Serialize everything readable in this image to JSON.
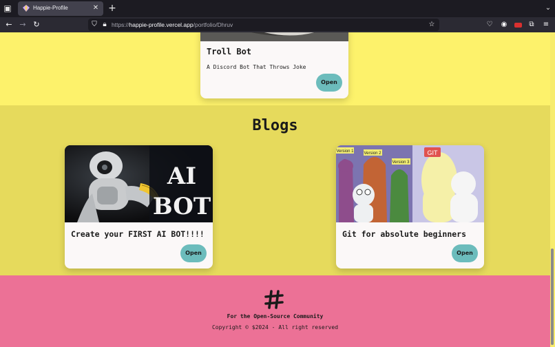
{
  "browser": {
    "tab_title": "Happie-Profile",
    "tab_close": "✕",
    "new_tab": "+",
    "url_prefix": "https://",
    "url_host": "happie-profile.vercel.app",
    "url_path": "/portfolio/Dhruv",
    "icons": [
      "tab-list-icon",
      "back-icon",
      "forward-icon",
      "reload-icon",
      "shield-icon",
      "lock-icon",
      "bookmark-star-icon",
      "pocket-icon",
      "account-icon",
      "extension-icon",
      "puzzle-icon",
      "menu-icon"
    ]
  },
  "projects": {
    "card": {
      "title": "Troll Bot",
      "description": "A Discord Bot That Throws Joke",
      "open_label": "Open"
    }
  },
  "blogs": {
    "heading": "Blogs",
    "cards": [
      {
        "title": "Create your FIRST AI BOT!!!!",
        "image_text_1": "AI",
        "image_text_2": "BOT",
        "open_label": "Open"
      },
      {
        "title": "Git for absolute beginners",
        "image_labels": [
          "Version 1",
          "Version 2",
          "Version 3",
          "GIT"
        ],
        "open_label": "Open"
      }
    ]
  },
  "footer": {
    "tagline": "For the Open-Source Community",
    "copyright": "Copyright © $2024 - All right reserved"
  },
  "colors": {
    "projects_bg": "#fdf26b",
    "blogs_bg": "#e6da5c",
    "footer_bg": "#ec7196",
    "button_bg": "#6cbcbc"
  }
}
